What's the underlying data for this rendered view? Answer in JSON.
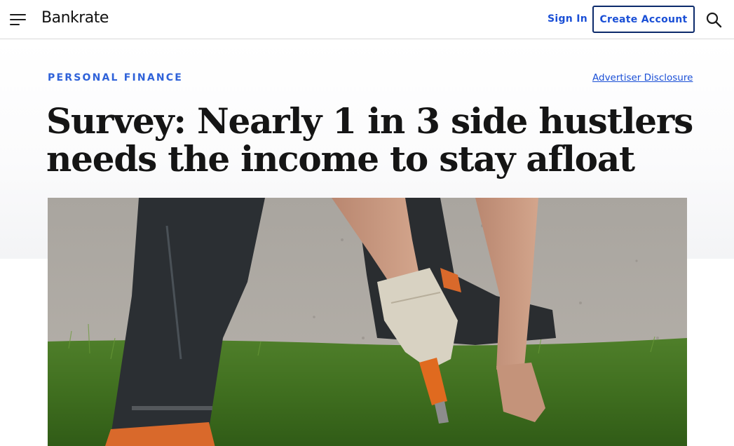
{
  "header": {
    "logo": "Bankrate",
    "sign_in": "Sign In",
    "create_account": "Create Account",
    "icons": {
      "menu": "hamburger-menu-icon",
      "search": "search-icon"
    }
  },
  "article": {
    "category": "PERSONAL FINANCE",
    "advertiser_disclosure": "Advertiser Disclosure",
    "headline_line1": "Survey: Nearly 1 in 3 side hustlers",
    "headline_line2": "needs the income to stay afloat"
  },
  "colors": {
    "accent_blue": "#1a4fd6",
    "button_border": "#0c2a6b",
    "headline": "#151515"
  }
}
